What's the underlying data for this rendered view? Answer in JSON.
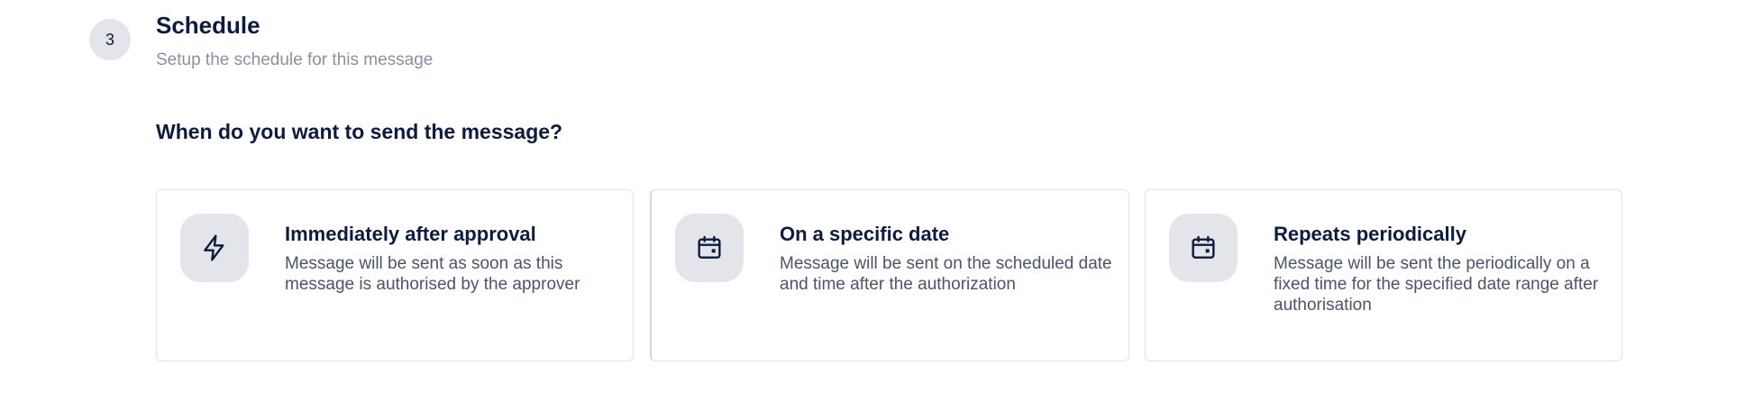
{
  "step": {
    "number": "3",
    "title": "Schedule",
    "subtitle": "Setup the schedule for this message"
  },
  "question": "When do you want to send the message?",
  "options": [
    {
      "icon": "lightning-icon",
      "title": "Immediately after approval",
      "description": "Message will be sent as soon as this message is authorised by the approver"
    },
    {
      "icon": "calendar-icon",
      "title": "On a specific date",
      "description": "Message will be sent on the scheduled date and time after the authorization"
    },
    {
      "icon": "calendar-icon",
      "title": "Repeats periodically",
      "description": "Message will be sent the periodically on a fixed time for the specified date range after authorisation"
    }
  ],
  "colors": {
    "text_primary": "#0f1b3d",
    "text_muted": "#8a91a1",
    "tile_bg": "#e3e5ea",
    "border": "#e1e3e8"
  }
}
